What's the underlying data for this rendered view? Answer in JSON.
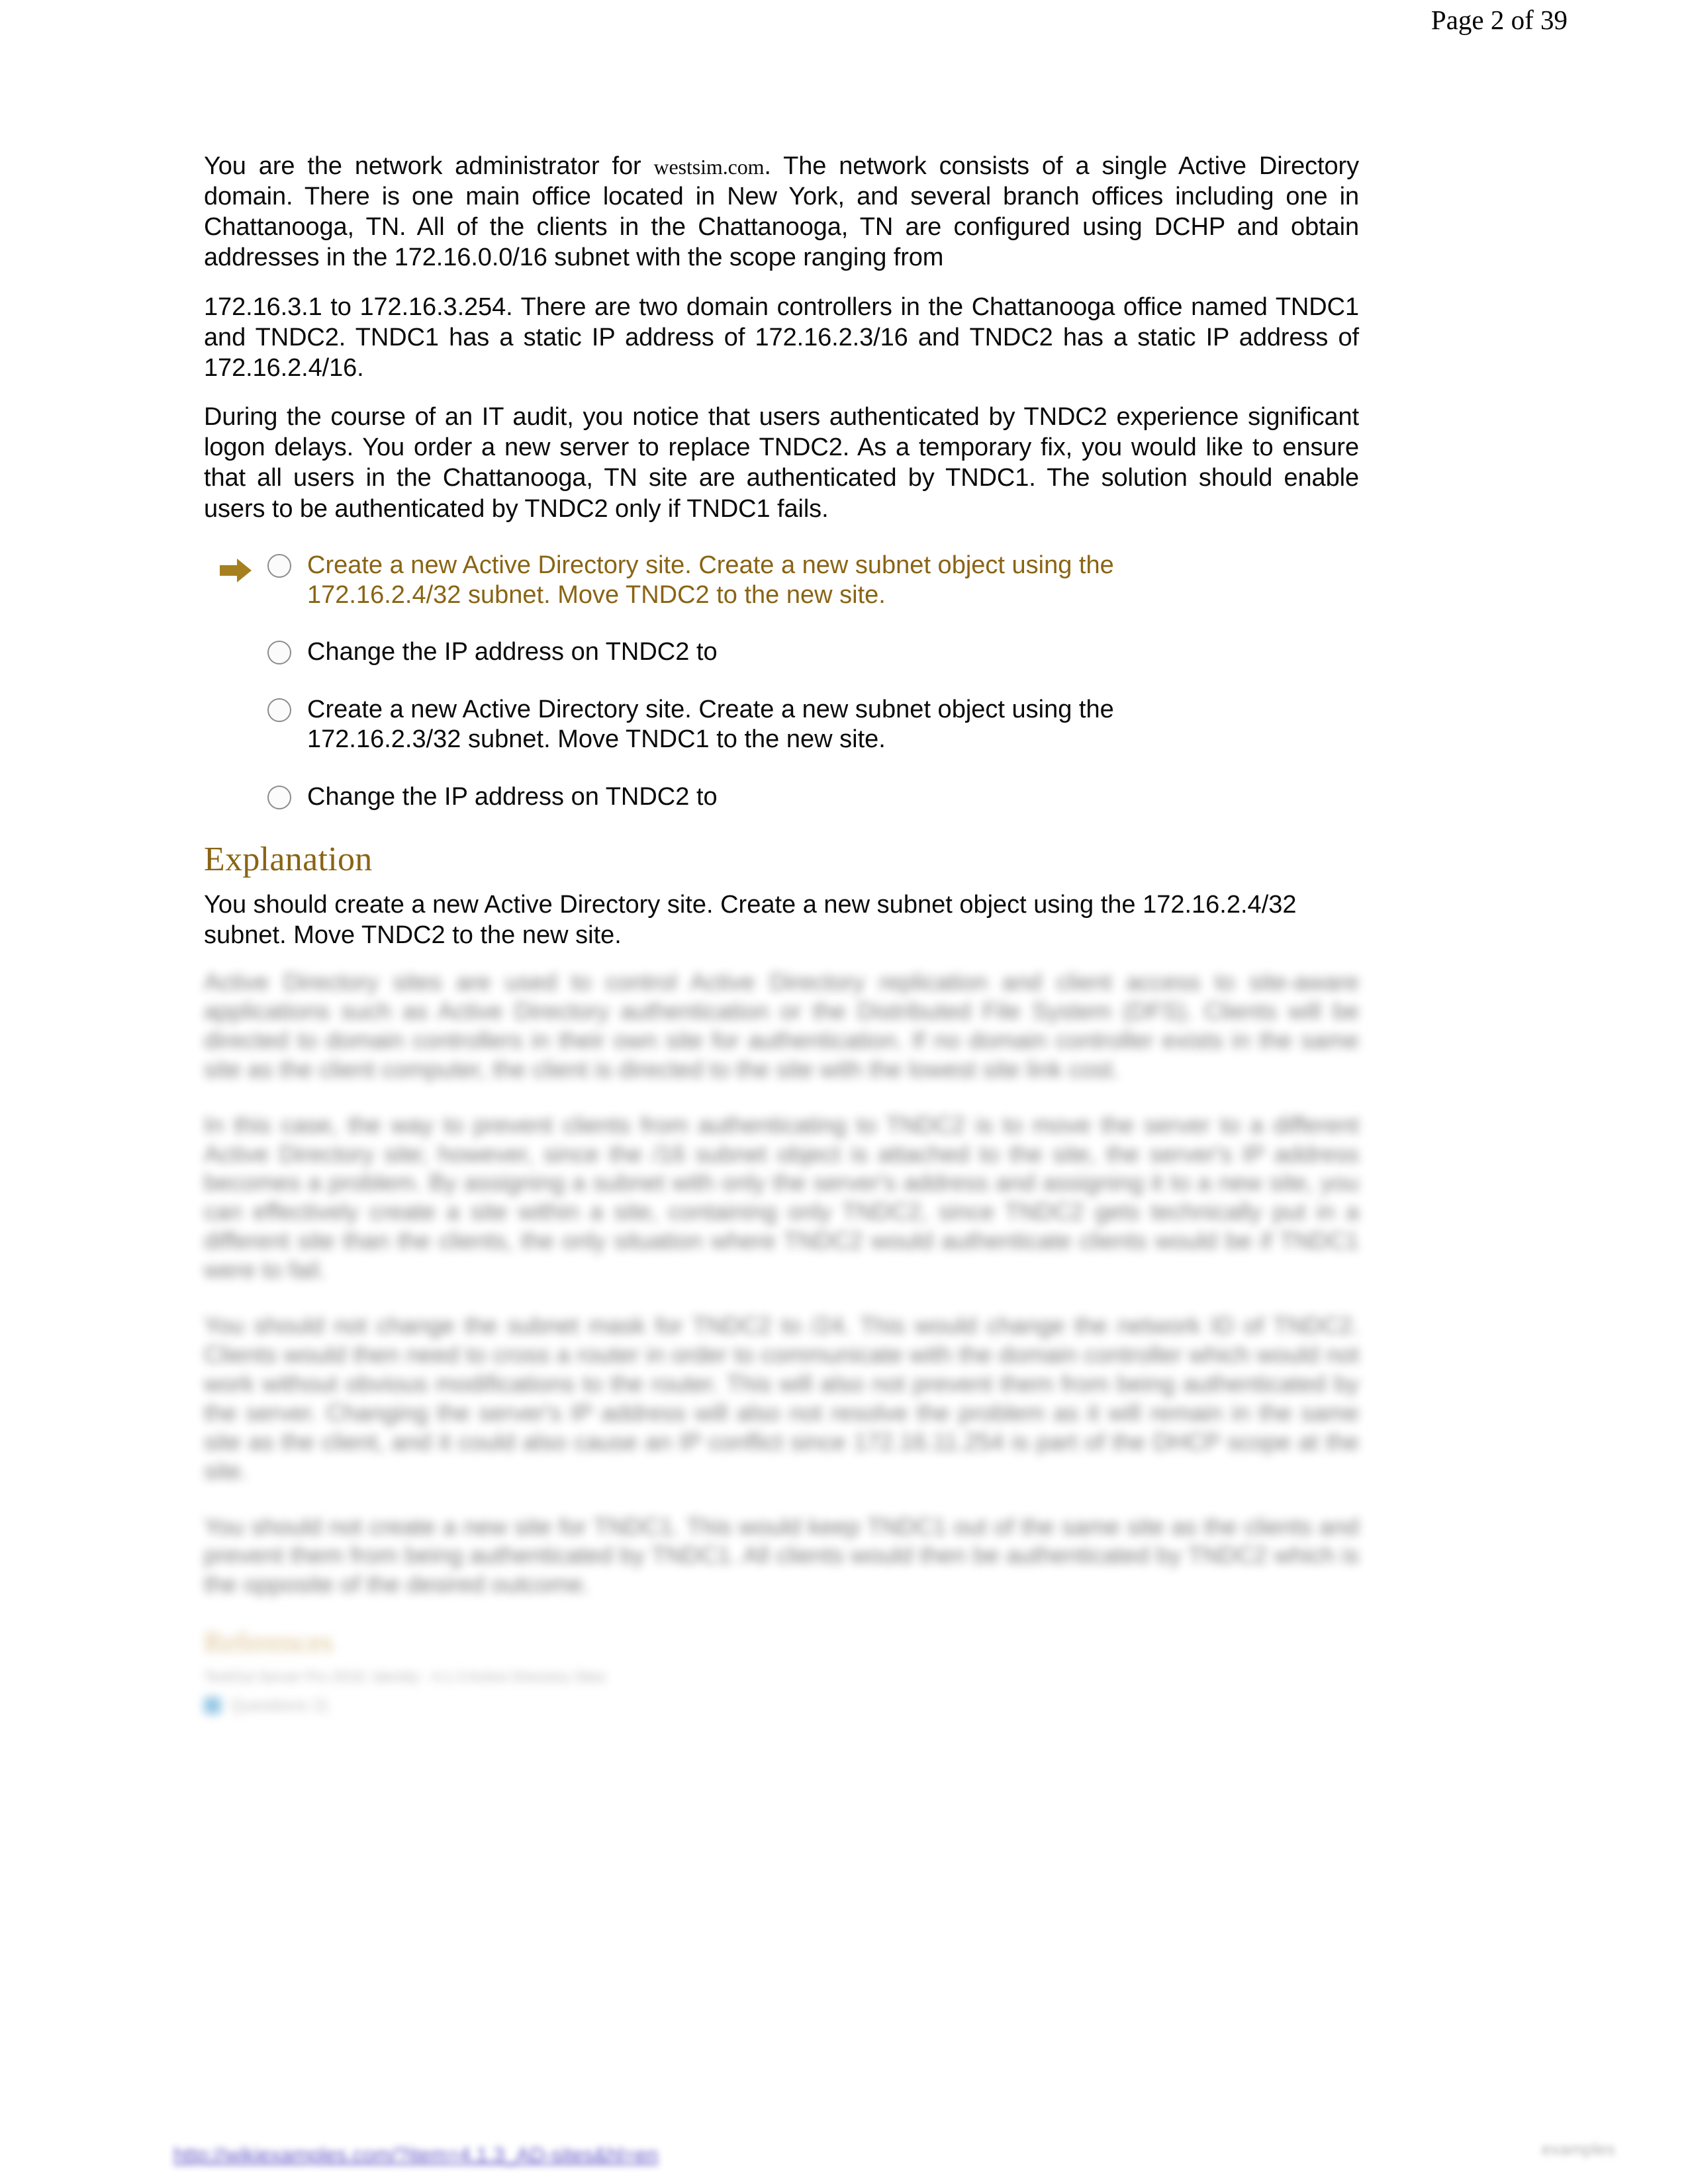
{
  "header": {
    "page_indicator": "Page 2 of 39"
  },
  "scenario": {
    "paragraph_1_part_1": "You are the network administrator for ",
    "paragraph_1_domain": "westsim.com",
    "paragraph_1_part_2": ". The network consists of a single Active Directory domain. There is one main office located in New York, and several branch offices including one in Chattanooga, TN. All of the clients in the Chattanooga, TN are configured using DCHP and obtain addresses in the 172.16.0.0/16 subnet with the scope ranging from",
    "paragraph_1_line_2": "172.16.3.1 to 172.16.3.254. There are two domain controllers in the Chattanooga office named TNDC1 and TNDC2. TNDC1 has a static IP address of 172.16.2.3/16 and TNDC2 has a static IP address of 172.16.2.4/16.",
    "paragraph_2": "During the course of an IT audit, you notice that users authenticated by TNDC2 experience significant logon delays. You order a new server to replace TNDC2. As a temporary fix, you would like to ensure that all users in the Chattanooga, TN site are authenticated by TNDC1. The solution should enable users to be authenticated by TNDC2 only if TNDC1 fails."
  },
  "answers": {
    "marker_icon": "arrow-right-icon",
    "highlight_color": "#8a6414",
    "options": [
      {
        "label": "Create a new Active Directory site. Create a new subnet object using the 172.16.2.4/32 subnet. Move TNDC2 to the new site.",
        "highlighted": true,
        "selected": false
      },
      {
        "label": "Change the IP address on TNDC2 to",
        "highlighted": false,
        "selected": false
      },
      {
        "label": "Create a new Active Directory site. Create a new subnet object using the 172.16.2.3/32 subnet. Move TNDC1 to the new site.",
        "highlighted": false,
        "selected": false
      },
      {
        "label": "Change the IP address on TNDC2 to",
        "highlighted": false,
        "selected": false
      }
    ]
  },
  "explanation": {
    "title": "Explanation",
    "summary": "You should create a new Active Directory site. Create a new subnet object using the 172.16.2.4/32 subnet. Move TNDC2 to the new site.",
    "obscured_paragraphs": [
      "Active Directory sites are used to control Active Directory replication and client access to site-aware applications such as Active Directory authentication or the Distributed File System (DFS). Clients will be directed to domain controllers in their own site for authentication. If no domain controller exists in the same site as the client computer, the client is directed to the site with the lowest site link cost.",
      "In this case, the way to prevent clients from authenticating to TNDC2 is to move the server to a different Active Directory site; however, since the /16 subnet object is attached to the site, the server's IP address becomes a problem. By assigning a subnet with only the server's address and assigning it to a new site, you can effectively create a site within a site, containing only TNDC2, since TNDC2 gets technically put in a different site than the clients, the only situation where TNDC2 would authenticate clients would be if TNDC1 were to fail.",
      "You should not change the subnet mask for TNDC2 to /24. This would change the network ID of TNDC2. Clients would then need to cross a router in order to communicate with the domain controller which would not work without obvious modifications to the router. This will also not prevent them from being authenticated by the server. Changing the server's IP address will also not resolve the problem as it will remain in the same site as the client, and it could also cause an IP conflict since 172.16.11.254 is part of the DHCP scope at the site.",
      "You should not create a new site for TNDC1. This would keep TNDC1 out of the same site as the clients and prevent them from being authenticated by TNDC1. All clients would then be authenticated by TNDC2 which is the opposite of the desired outcome."
    ],
    "references_heading": "References",
    "reference_line": "TestOut Server Pro 2016: Identity - 4.1.3 Active Directory Sites",
    "reference_item": "Questions 2)"
  },
  "footer": {
    "link_text": "http://wikiexamples.com/?item=4.1.3_AD-sites&hl=en",
    "right_text": "examples"
  }
}
